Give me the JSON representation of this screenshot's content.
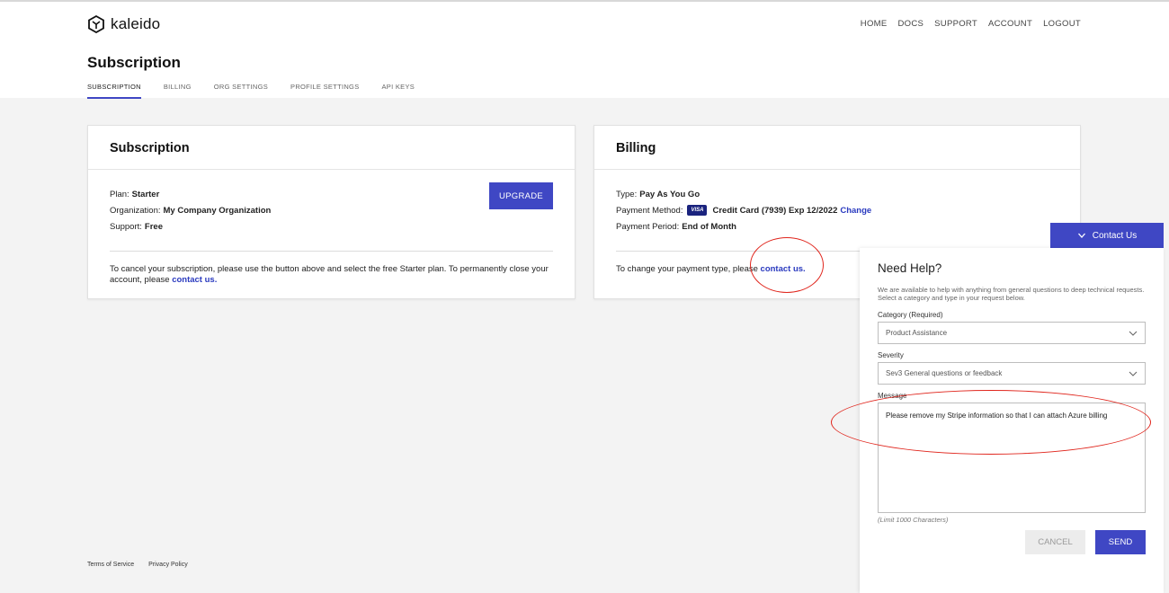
{
  "brand": {
    "name": "kaleido"
  },
  "topnav": [
    "HOME",
    "DOCS",
    "SUPPORT",
    "ACCOUNT",
    "LOGOUT"
  ],
  "page": {
    "title": "Subscription"
  },
  "subtabs": [
    "SUBSCRIPTION",
    "BILLING",
    "ORG SETTINGS",
    "PROFILE SETTINGS",
    "API KEYS"
  ],
  "subscription_card": {
    "title": "Subscription",
    "plan_label": "Plan:",
    "plan_value": "Starter",
    "org_label": "Organization:",
    "org_value": "My Company Organization",
    "support_label": "Support:",
    "support_value": "Free",
    "upgrade_label": "UPGRADE",
    "note_text": "To cancel your subscription, please use the button above and select the free Starter plan. To permanently close your account, please ",
    "note_link": "contact us."
  },
  "billing_card": {
    "title": "Billing",
    "type_label": "Type:",
    "type_value": "Pay As You Go",
    "method_label": "Payment Method:",
    "card_brand": "VISA",
    "method_value": "Credit Card (7939) Exp 12/2022",
    "change_link": "Change",
    "period_label": "Payment Period:",
    "period_value": "End of Month",
    "note_text": "To change your payment type, please ",
    "note_link": "contact us."
  },
  "footer": {
    "terms": "Terms of Service",
    "privacy": "Privacy Policy"
  },
  "contact": {
    "tab_label": "Contact Us",
    "title": "Need Help?",
    "description": "We are available to help with anything from general questions to deep technical requests. Select a category and type in your request below.",
    "category_label": "Category (Required)",
    "category_value": "Product Assistance",
    "severity_label": "Severity",
    "severity_value": "Sev3 General questions or feedback",
    "message_label": "Message",
    "message_value": "Please remove my Stripe information so that I can attach Azure billing",
    "limit": "(Limit 1000 Characters)",
    "cancel_label": "CANCEL",
    "send_label": "SEND"
  },
  "colors": {
    "accent": "#3f47c4",
    "link": "#2a3abf",
    "annotation": "#e0251c"
  }
}
